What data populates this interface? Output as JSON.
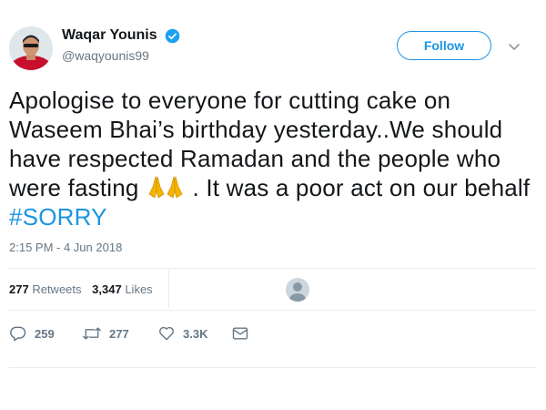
{
  "user": {
    "display_name": "Waqar Younis",
    "handle": "@waqyounis99",
    "verified": true
  },
  "follow_button": {
    "label": "Follow"
  },
  "tweet": {
    "text_part1": "Apologise to everyone for cutting cake on Waseem Bhai’s birthday yesterday..We should have respected Ramadan and the people who were fasting",
    "emoji": "🙏🙏",
    "text_part2": ". It was a poor act on our behalf ",
    "hashtag": "#SORRY",
    "timestamp": "2:15 PM - 4 Jun 2018"
  },
  "stats": {
    "retweets_count": "277",
    "retweets_label": "Retweets",
    "likes_count": "3,347",
    "likes_label": "Likes"
  },
  "actions": {
    "reply_count": "259",
    "retweet_count": "277",
    "like_count": "3.3K"
  },
  "colors": {
    "accent": "#1b95e0",
    "secondary_text": "#657786",
    "divider": "#e6ecf0"
  },
  "icons": [
    "verified-badge-icon",
    "chevron-down-icon",
    "praying-hands-emoji",
    "reply-icon",
    "retweet-icon",
    "heart-icon",
    "mail-icon"
  ]
}
